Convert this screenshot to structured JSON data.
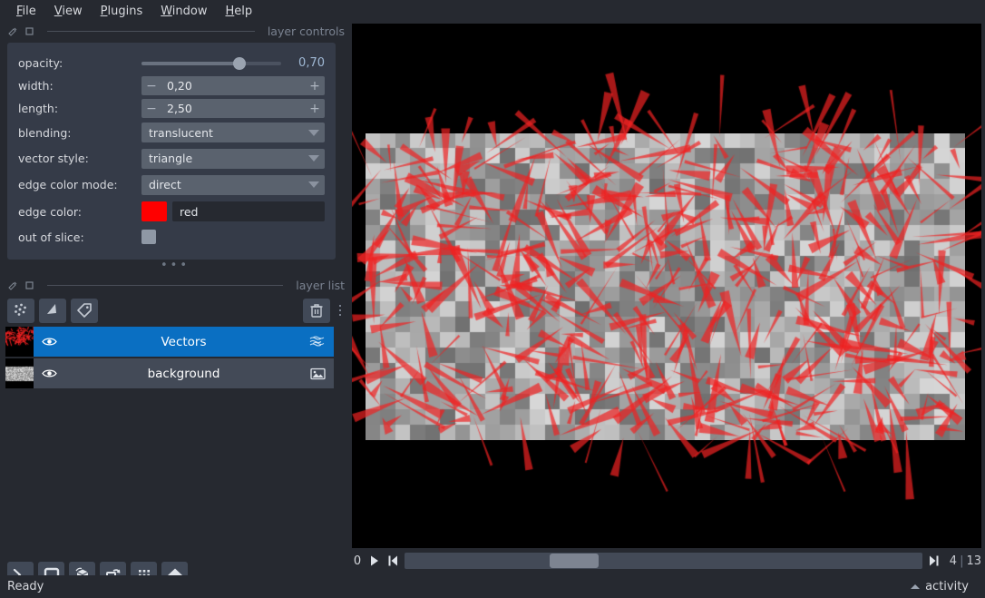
{
  "app": {
    "status_text": "Ready",
    "activity_label": "activity",
    "accent_color": "#0a6fc2",
    "edge_color_hex": "#ff0000"
  },
  "menubar": {
    "items": [
      {
        "label": "File",
        "mnemonic": "F"
      },
      {
        "label": "View",
        "mnemonic": "V"
      },
      {
        "label": "Plugins",
        "mnemonic": "P"
      },
      {
        "label": "Window",
        "mnemonic": "W"
      },
      {
        "label": "Help",
        "mnemonic": "H"
      }
    ]
  },
  "layer_controls": {
    "dock_title": "layer controls",
    "opacity": {
      "label": "opacity:",
      "value": "0,70",
      "percent": 70
    },
    "width": {
      "label": "width:",
      "value": "0,20"
    },
    "length": {
      "label": "length:",
      "value": "2,50"
    },
    "blending": {
      "label": "blending:",
      "value": "translucent"
    },
    "vector_style": {
      "label": "vector style:",
      "value": "triangle"
    },
    "edge_color_mode": {
      "label": "edge color mode:",
      "value": "direct"
    },
    "edge_color": {
      "label": "edge color:",
      "value": "red",
      "swatch": "#ff0000"
    },
    "out_of_slice": {
      "label": "out of slice:",
      "checked": false
    }
  },
  "layer_list": {
    "dock_title": "layer list",
    "buttons": [
      {
        "name": "new-points-layer",
        "icon": "points-icon"
      },
      {
        "name": "new-shapes-layer",
        "icon": "shapes-icon"
      },
      {
        "name": "new-labels-layer",
        "icon": "labels-icon"
      },
      {
        "name": "delete-layer",
        "icon": "trash-icon"
      }
    ],
    "layers": [
      {
        "name": "Vectors",
        "type": "vectors",
        "visible": true,
        "selected": true
      },
      {
        "name": "background",
        "type": "image",
        "visible": true,
        "selected": false
      }
    ]
  },
  "viewer_buttons": [
    {
      "name": "console-button",
      "icon": "console-icon"
    },
    {
      "name": "ndisplay-2d-button",
      "icon": "square-icon"
    },
    {
      "name": "ndisplay-3d-button",
      "icon": "cube-icon"
    },
    {
      "name": "roll-dims-button",
      "icon": "roll-icon"
    },
    {
      "name": "grid-view-button",
      "icon": "grid-icon"
    },
    {
      "name": "home-button",
      "icon": "home-icon"
    }
  ],
  "dims": {
    "axis_label": "0",
    "current": "4",
    "separator": "|",
    "total": "13",
    "handle_percent": 28,
    "play_label": "play",
    "prev_label": "first frame",
    "next_label": "last frame"
  },
  "canvas": {
    "background": "#000000",
    "image_layer": {
      "description": "pixelated grayscale noise",
      "cols": 40,
      "rows": 20,
      "gray_min": 110,
      "gray_max": 215
    },
    "vectors_layer": {
      "description": "red triangle vectors",
      "count": 520,
      "color": "#ee2222",
      "opacity": 0.7
    }
  }
}
